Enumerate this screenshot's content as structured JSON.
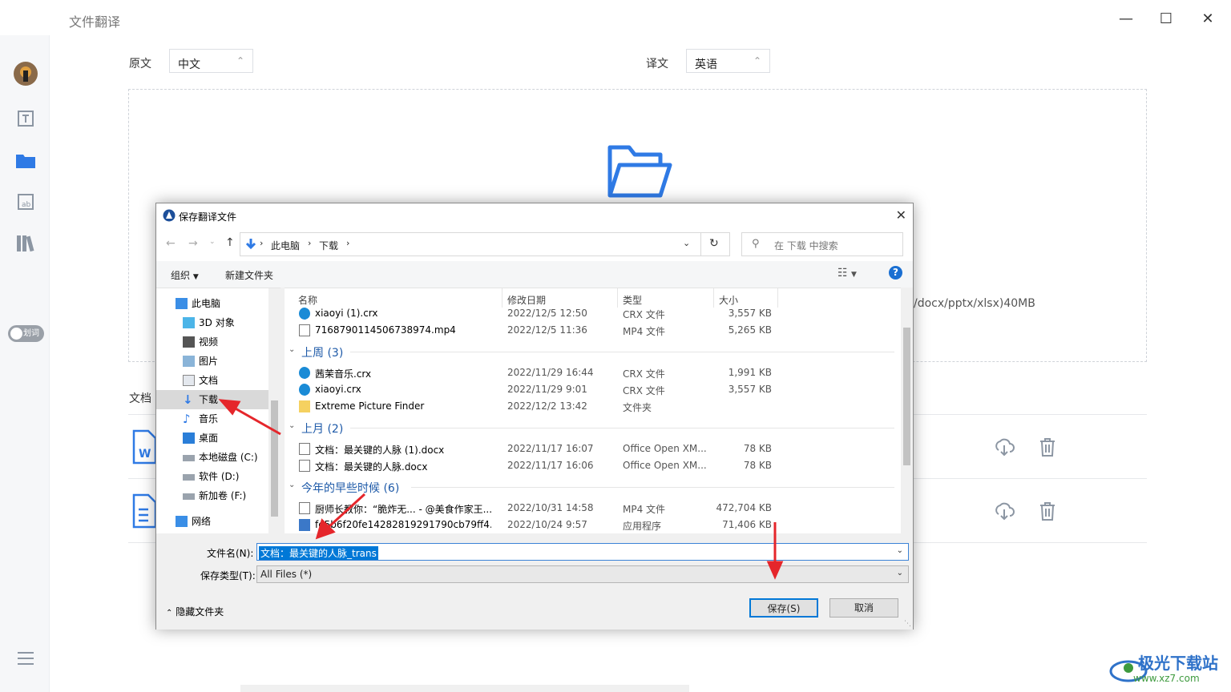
{
  "app": {
    "title": "文件翻译",
    "source_label": "原文",
    "source_lang": "中文",
    "target_label": "译文",
    "target_lang": "英语",
    "format_hint": "/docx/pptx/xlsx)40MB",
    "doc_section_label": "文档",
    "toggle_label": "划词",
    "accent_color": "#2f7ae5"
  },
  "dialog": {
    "title": "保存翻译文件",
    "breadcrumb": [
      "此电脑",
      "下载"
    ],
    "search_placeholder": "在 下载 中搜索",
    "toolbar": {
      "organize": "组织",
      "new_folder": "新建文件夹"
    },
    "nav_items": [
      {
        "label": "此电脑",
        "icon": "computer-icon"
      },
      {
        "label": "3D 对象",
        "icon": "cube-icon"
      },
      {
        "label": "视频",
        "icon": "video-icon"
      },
      {
        "label": "图片",
        "icon": "picture-icon"
      },
      {
        "label": "文档",
        "icon": "document-icon"
      },
      {
        "label": "下载",
        "icon": "download-icon"
      },
      {
        "label": "音乐",
        "icon": "music-icon"
      },
      {
        "label": "桌面",
        "icon": "desktop-icon"
      },
      {
        "label": "本地磁盘 (C:)",
        "icon": "drive-icon"
      },
      {
        "label": "软件 (D:)",
        "icon": "drive-icon"
      },
      {
        "label": "新加卷 (F:)",
        "icon": "drive-icon"
      },
      {
        "label": "网络",
        "icon": "network-icon"
      }
    ],
    "columns": {
      "name": "名称",
      "date": "修改日期",
      "type": "类型",
      "size": "大小"
    },
    "rows_top": [
      {
        "name": "xiaoyi (1).crx",
        "date": "2022/12/5 12:50",
        "type": "CRX 文件",
        "size": "3,557 KB",
        "icon": "edge-icon"
      },
      {
        "name": "716879011450673​8974.mp4",
        "date": "2022/12/5 11:36",
        "type": "MP4 文件",
        "size": "5,265 KB",
        "icon": "file-icon"
      }
    ],
    "group1": {
      "label": "上周 (3)",
      "rows": [
        {
          "name": "茜茉音乐.crx",
          "date": "2022/11/29 16:44",
          "type": "CRX 文件",
          "size": "1,991 KB",
          "icon": "edge-icon"
        },
        {
          "name": "xiaoyi.crx",
          "date": "2022/11/29 9:01",
          "type": "CRX 文件",
          "size": "3,557 KB",
          "icon": "edge-icon"
        },
        {
          "name": "Extreme Picture Finder",
          "date": "2022/12/2 13:42",
          "type": "文件夹",
          "size": "",
          "icon": "folder-icon"
        }
      ]
    },
    "group2": {
      "label": "上月 (2)",
      "rows": [
        {
          "name": "文档：最关键的人脉 (1).docx",
          "date": "2022/11/17 16:07",
          "type": "Office Open XM...",
          "size": "78 KB",
          "icon": "file-icon"
        },
        {
          "name": "文档：最关键的人脉.docx",
          "date": "2022/11/17 16:06",
          "type": "Office Open XM...",
          "size": "78 KB",
          "icon": "file-icon"
        }
      ]
    },
    "group3": {
      "label": "今年的早些时候 (6)",
      "rows": [
        {
          "name": "厨师长教你：“脆炸无... - @美食作家王...",
          "date": "2022/10/31 14:58",
          "type": "MP4 文件",
          "size": "472,704 KB",
          "icon": "file-icon"
        },
        {
          "name": "fe5b6f20fe14282819291790cb79ff4....",
          "date": "2022/10/24 9:57",
          "type": "应用程序",
          "size": "71,406 KB",
          "icon": "app-icon"
        }
      ]
    },
    "filename_label": "文件名(N):",
    "filename_value": "文档：最关键的人脉_trans",
    "filetype_label": "保存类型(T):",
    "filetype_value": "All Files (*)",
    "hide_folders": "隐藏文件夹",
    "save_button": "保存(S)",
    "cancel_button": "取消"
  },
  "watermark": {
    "text": "极光下载站",
    "sub": "www.xz7.com"
  }
}
